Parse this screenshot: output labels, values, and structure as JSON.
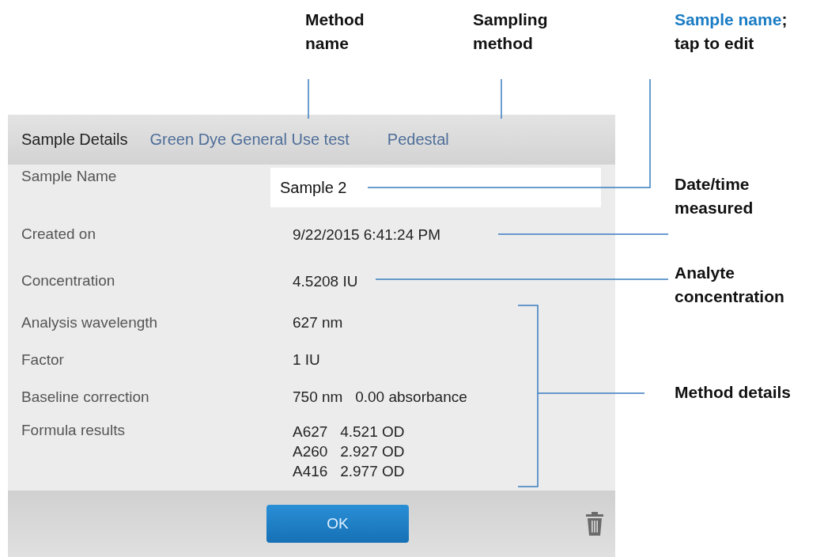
{
  "callouts": [
    {
      "text": "Method name"
    },
    {
      "text": "Sampling method"
    },
    {
      "highlight": "Sample name",
      "text": "; tap to edit"
    },
    {
      "text": "Date/time measured"
    },
    {
      "text": "Analyte concentration"
    },
    {
      "text": "Method details"
    }
  ],
  "header": {
    "title": "Sample Details",
    "method": "Green Dye General Use test",
    "sampling": "Pedestal"
  },
  "sample_name": {
    "label": "Sample Name",
    "value": "Sample 2"
  },
  "details": [
    {
      "label": "Created on",
      "lines": [
        "9/22/2015 6:41:24 PM"
      ]
    },
    {
      "label": "Concentration",
      "lines": [
        "4.5208 IU"
      ]
    },
    {
      "label": "Analysis wavelength",
      "lines": [
        "627 nm"
      ]
    },
    {
      "label": "Factor",
      "lines": [
        "1 IU"
      ]
    },
    {
      "label": "Baseline correction",
      "lines": [
        "750 nm   0.00 absorbance"
      ]
    },
    {
      "label": "Formula results",
      "lines": [
        "A627   4.521 OD",
        "A260   2.927 OD",
        "A416   2.977 OD"
      ]
    }
  ],
  "footer": {
    "ok": "OK"
  }
}
